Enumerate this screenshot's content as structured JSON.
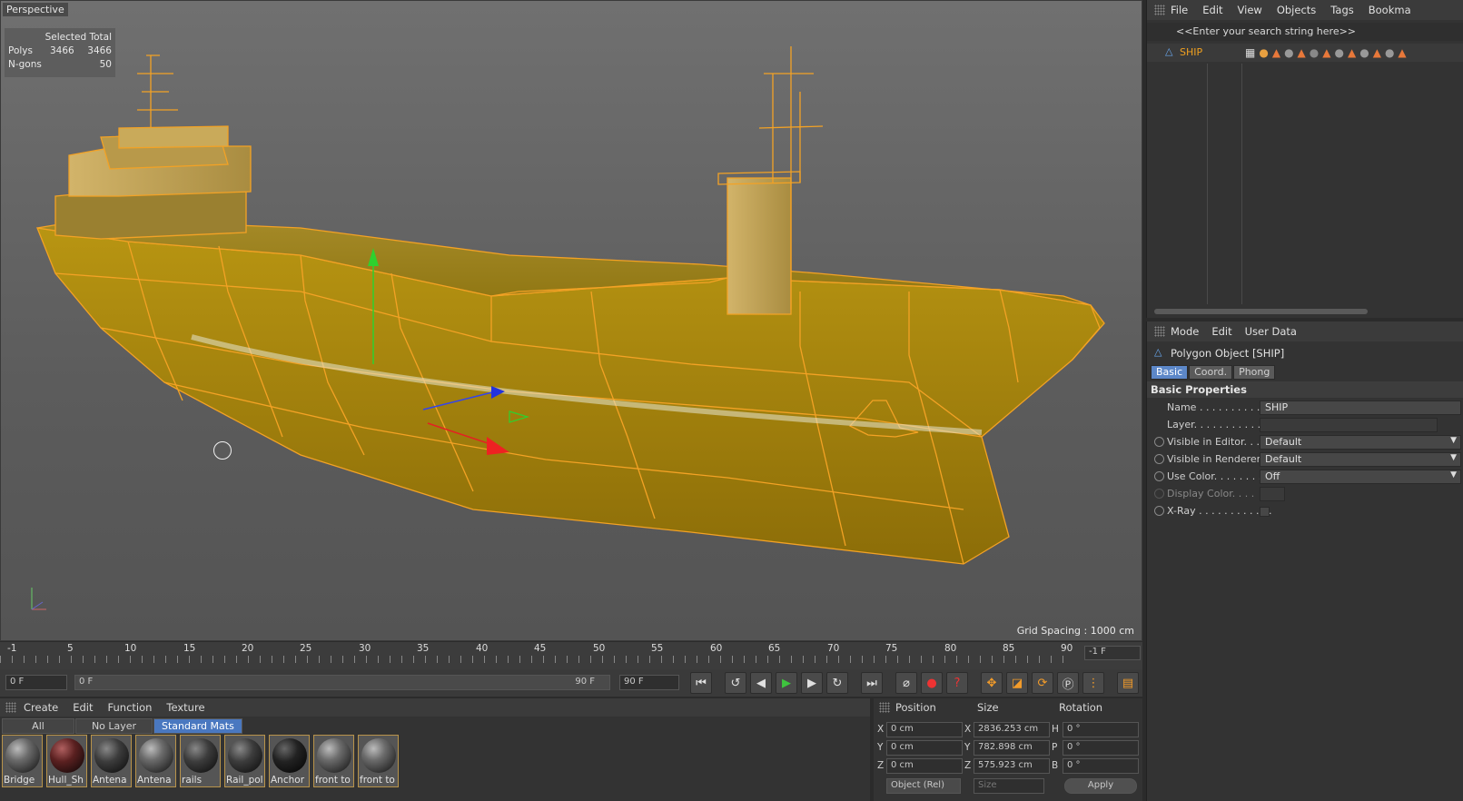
{
  "viewport": {
    "title": "Perspective",
    "stats": {
      "header": "Selected Total",
      "rows": [
        {
          "label": "Polys",
          "selected": "3466",
          "total": "3466"
        },
        {
          "label": "N-gons",
          "selected": "",
          "total": "50"
        }
      ]
    },
    "grid_spacing": "Grid Spacing : 1000 cm"
  },
  "timeline": {
    "start_label": "-1",
    "ticks": [
      "5",
      "10",
      "15",
      "20",
      "25",
      "30",
      "35",
      "40",
      "45",
      "50",
      "55",
      "60",
      "65",
      "70",
      "75",
      "80",
      "85",
      "90"
    ],
    "end_field": "-1 F",
    "current_frame": "0 F",
    "range_start": "0 F",
    "range_end": "90 F",
    "max_frame": "90 F"
  },
  "materials": {
    "menu": [
      "Create",
      "Edit",
      "Function",
      "Texture"
    ],
    "tabs": [
      "All",
      "No Layer",
      "Standard Mats"
    ],
    "active_tab": "Standard Mats",
    "items": [
      "Bridge",
      "Hull_Sh",
      "Antena",
      "Antena",
      "rails",
      "Rail_pol",
      "Anchor",
      "front to",
      "front to"
    ]
  },
  "coordinates": {
    "headers": {
      "position": "Position",
      "size": "Size",
      "rotation": "Rotation"
    },
    "rows": [
      {
        "axis": "X",
        "pos": "0 cm",
        "size_axis": "X",
        "size": "2836.253 cm",
        "rot_axis": "H",
        "rot": "0 °"
      },
      {
        "axis": "Y",
        "pos": "0 cm",
        "size_axis": "Y",
        "size": "782.898 cm",
        "rot_axis": "P",
        "rot": "0 °"
      },
      {
        "axis": "Z",
        "pos": "0 cm",
        "size_axis": "Z",
        "size": "575.923 cm",
        "rot_axis": "B",
        "rot": "0 °"
      }
    ],
    "mode": "Object (Rel)",
    "size_mode": "Size",
    "apply": "Apply"
  },
  "object_manager": {
    "menu": [
      "File",
      "Edit",
      "View",
      "Objects",
      "Tags",
      "Bookma"
    ],
    "search_placeholder": "<<Enter your search string here>>",
    "object_name": "SHIP"
  },
  "attributes": {
    "menu": [
      "Mode",
      "Edit",
      "User Data"
    ],
    "title": "Polygon Object [SHIP]",
    "tabs": [
      "Basic",
      "Coord.",
      "Phong"
    ],
    "active_tab": "Basic",
    "section": "Basic Properties",
    "rows": [
      {
        "label": "Name . . . . . . . . . . . .",
        "value": "SHIP"
      },
      {
        "label": "Layer. . . . . . . . . . . . .",
        "value": ""
      },
      {
        "label": "Visible in Editor. . .",
        "value": "Default"
      },
      {
        "label": "Visible in Renderer",
        "value": "Default"
      },
      {
        "label": "Use Color. . . . . . . . .",
        "value": "Off"
      },
      {
        "label": "Display Color. . . .",
        "value": ""
      },
      {
        "label": "X-Ray . . . . . . . . . . . .",
        "value": ""
      }
    ]
  },
  "colors": {
    "accent": "#4a78c0",
    "selection": "#f0a020",
    "ship": "#b08a10"
  }
}
